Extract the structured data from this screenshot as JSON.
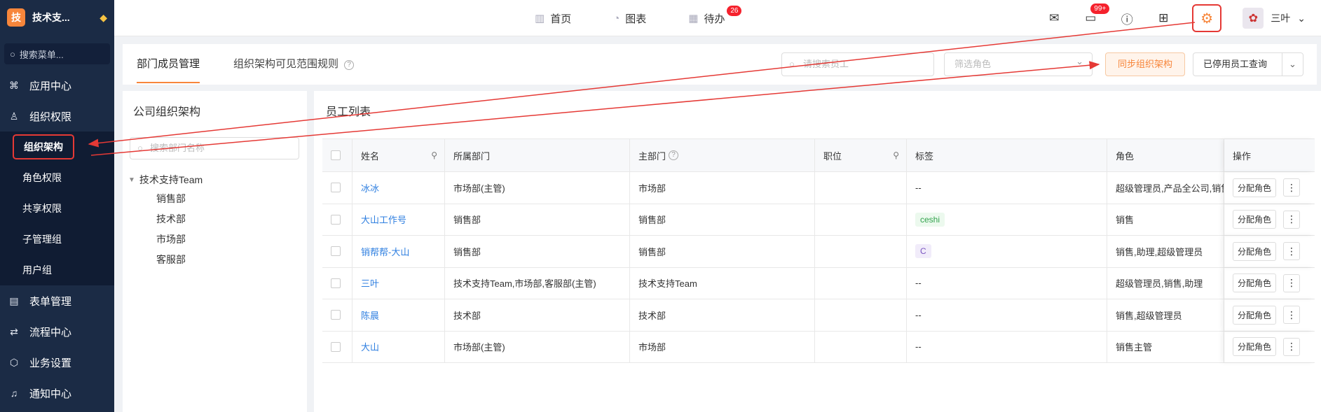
{
  "sidebar": {
    "brand_letter": "技",
    "brand_name": "技术支...",
    "search_placeholder": "搜索菜单...",
    "items": [
      {
        "label": "应用中心",
        "icon": "apps-icon"
      },
      {
        "label": "组织权限",
        "icon": "user-icon"
      },
      {
        "label": "表单管理",
        "icon": "form-icon"
      },
      {
        "label": "流程中心",
        "icon": "flow-icon"
      },
      {
        "label": "业务设置",
        "icon": "cube-icon"
      },
      {
        "label": "通知中心",
        "icon": "bell-icon"
      }
    ],
    "sub_items": [
      "组织架构",
      "角色权限",
      "共享权限",
      "子管理组",
      "用户组"
    ]
  },
  "header": {
    "tabs": [
      {
        "label": "首页",
        "icon": "home-icon"
      },
      {
        "label": "图表",
        "icon": "chart-icon"
      },
      {
        "label": "待办",
        "icon": "calendar-icon",
        "badge": "26"
      }
    ],
    "message_badge": "99+",
    "user_name": "三叶"
  },
  "main": {
    "tabs": [
      "部门成员管理",
      "组织架构可见范围规则"
    ],
    "search_placeholder": "请搜索员工",
    "role_placeholder": "筛选角色",
    "sync_label": "同步组织架构",
    "disabled_query_label": "已停用员工查询"
  },
  "org": {
    "title": "公司组织架构",
    "search_placeholder": "搜索部门名称",
    "root": "技术支持Team",
    "children": [
      "销售部",
      "技术部",
      "市场部",
      "客服部"
    ]
  },
  "employees": {
    "title": "员工列表",
    "columns": [
      "姓名",
      "所属部门",
      "主部门",
      "职位",
      "标签",
      "角色",
      "操作"
    ],
    "rows": [
      {
        "name": "冰冰",
        "dept": "市场部(主管)",
        "main": "市场部",
        "pos": "",
        "tag": "--",
        "tag_type": "none",
        "role": "超级管理员,产品全公司,销售",
        "op": "分配角色"
      },
      {
        "name": "大山工作号",
        "dept": "销售部",
        "main": "销售部",
        "pos": "",
        "tag": "ceshi",
        "tag_type": "green",
        "role": "销售",
        "op": "分配角色"
      },
      {
        "name": "销帮帮-大山",
        "dept": "销售部",
        "main": "销售部",
        "pos": "",
        "tag": "C",
        "tag_type": "purple",
        "role": "销售,助理,超级管理员",
        "op": "分配角色"
      },
      {
        "name": "三叶",
        "dept": "技术支持Team,市场部,客服部(主管)",
        "main": "技术支持Team",
        "pos": "",
        "tag": "--",
        "tag_type": "none",
        "role": "超级管理员,销售,助理",
        "op": "分配角色"
      },
      {
        "name": "陈晨",
        "dept": "技术部",
        "main": "技术部",
        "pos": "",
        "tag": "--",
        "tag_type": "none",
        "role": "销售,超级管理员",
        "op": "分配角色"
      },
      {
        "name": "大山",
        "dept": "市场部(主管)",
        "main": "市场部",
        "pos": "",
        "tag": "--",
        "tag_type": "none",
        "role": "销售主管",
        "op": "分配角色"
      }
    ]
  },
  "colors": {
    "accent": "#f7863b",
    "sidebar_bg": "#1b2b45",
    "annotation": "#e53935",
    "link": "#2f7fe0"
  }
}
